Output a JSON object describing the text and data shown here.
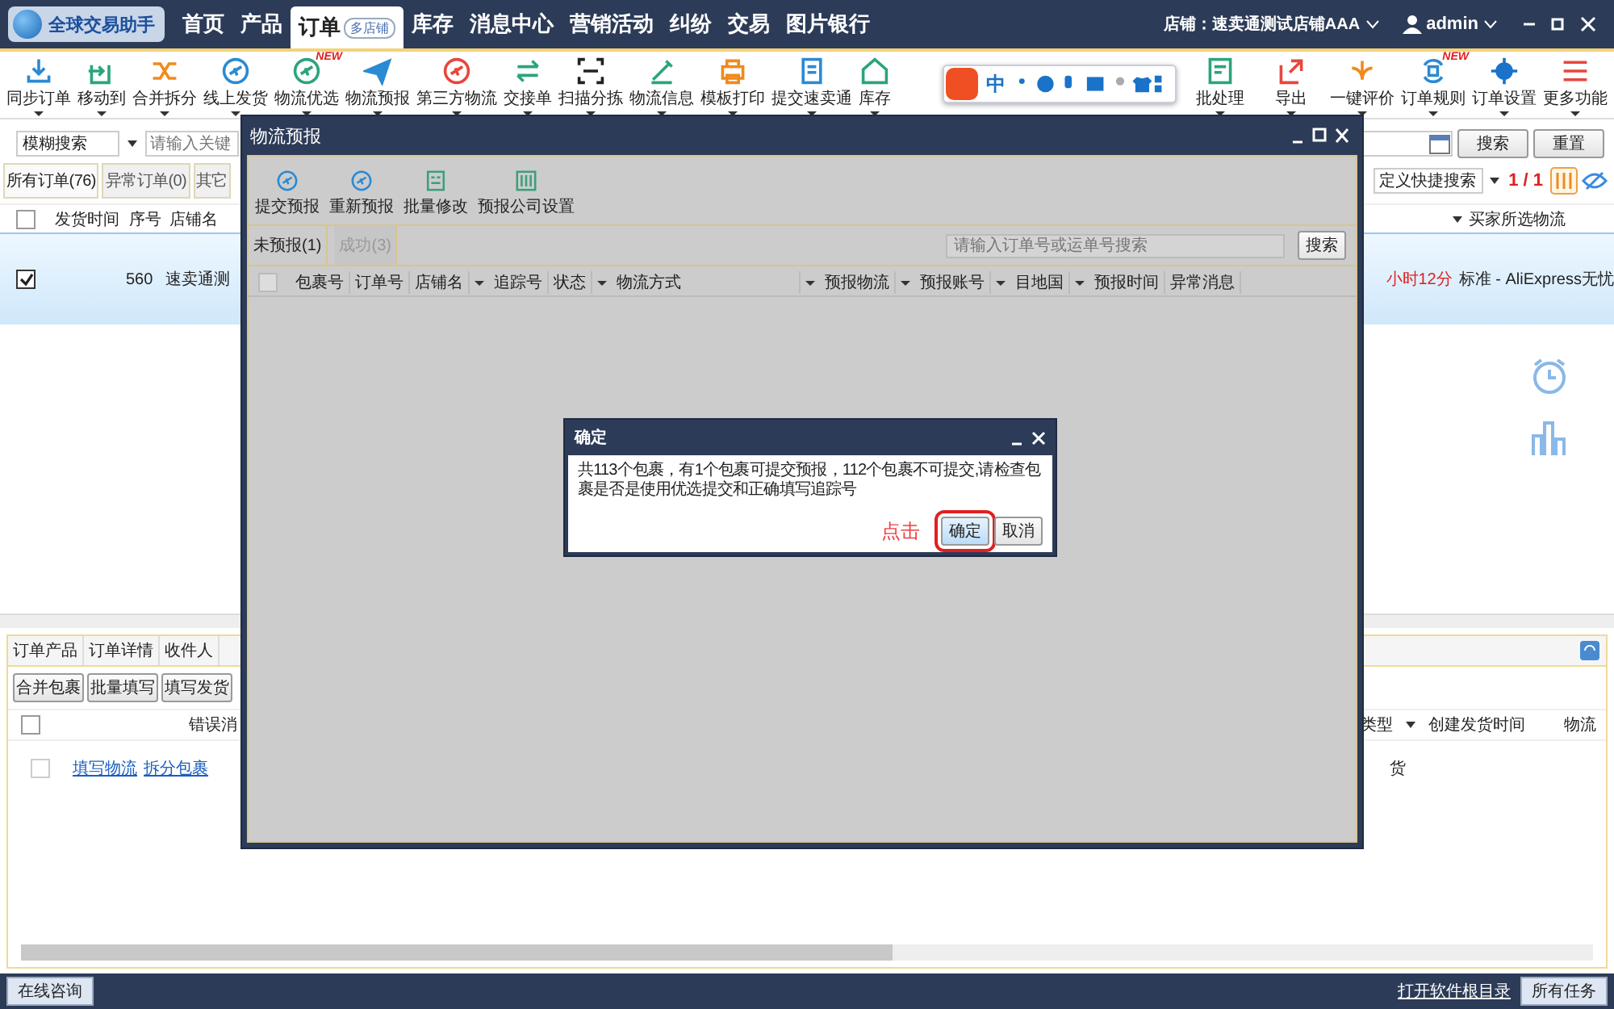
{
  "app": {
    "logo": "全球交易助手"
  },
  "nav": [
    {
      "label": "首页",
      "selected": false
    },
    {
      "label": "产品",
      "selected": false
    },
    {
      "label": "订单",
      "selected": true,
      "badge": "多店铺"
    },
    {
      "label": "库存",
      "selected": false
    },
    {
      "label": "消息中心",
      "selected": false
    },
    {
      "label": "营销活动",
      "selected": false
    },
    {
      "label": "纠纷",
      "selected": false
    },
    {
      "label": "交易",
      "selected": false
    },
    {
      "label": "图片银行",
      "selected": false
    }
  ],
  "store": "店铺：速卖通测试店铺AAA",
  "user": "admin",
  "toolbar": [
    {
      "label": "同步订单"
    },
    {
      "label": "移动到"
    },
    {
      "label": "合并拆分"
    },
    {
      "label": "线上发货"
    },
    {
      "label": "物流优选",
      "badge": "NEW"
    },
    {
      "label": "物流预报"
    },
    {
      "label": "第三方物流"
    },
    {
      "label": "交接单"
    },
    {
      "label": "扫描分拣"
    },
    {
      "label": "物流信息"
    },
    {
      "label": "模板打印"
    },
    {
      "label": "提交速卖通"
    },
    {
      "label": "库存"
    }
  ],
  "toolbar_right": [
    {
      "label": "批处理"
    },
    {
      "label": "导出"
    },
    {
      "label": "一键评价"
    },
    {
      "label": "订单规则",
      "badge": "NEW"
    },
    {
      "label": "订单设置"
    },
    {
      "label": "更多功能"
    }
  ],
  "ime": {
    "label": "中"
  },
  "filter": {
    "mode": "模糊搜索",
    "placeholder": "请输入关键",
    "search": "搜索",
    "reset": "重置"
  },
  "order_tabs": [
    {
      "label": "所有订单(76)",
      "selected": true
    },
    {
      "label": "异常订单(0)",
      "selected": false
    },
    {
      "label": "其它",
      "selected": false
    }
  ],
  "quick_search": "定义快捷搜索",
  "page": "1 / 1",
  "orders": {
    "select_all": {
      "checked": false
    },
    "columns": [
      "发货时间",
      "序号",
      "店铺名",
      "买家所选物流"
    ],
    "rows": [
      {
        "checked": true,
        "selected": true,
        "number": "560",
        "store": "速卖通测",
        "time_left": "小时12分",
        "shipping": "标准 - AliExpress无忧"
      }
    ]
  },
  "bottom": {
    "tabs": [
      "订单产品",
      "订单详情",
      "收件人"
    ],
    "buttons": [
      "合并包裹",
      "批量填写",
      "填写发货"
    ],
    "select_all": {
      "checked": false
    },
    "columns": [
      "错误消",
      "类型",
      "创建发货时间",
      "物流"
    ],
    "rows": [
      {
        "checked": false,
        "links": [
          "填写物流",
          "拆分包裹"
        ],
        "cell": "货"
      }
    ]
  },
  "status_bar": {
    "consult": "在线咨询",
    "open_dir": "打开软件根目录",
    "tasks": "所有任务"
  },
  "modal": {
    "title": "物流预报",
    "tools": [
      "提交预报",
      "重新预报",
      "批量修改",
      "预报公司设置"
    ],
    "tabs": [
      {
        "label": "未预报(1)",
        "selected": true
      },
      {
        "label": "成功(3)",
        "selected": false
      }
    ],
    "search_placeholder": "请输入订单号或运单号搜索",
    "search": "搜索",
    "select_all": {
      "checked": false
    },
    "columns": [
      {
        "label": "包裹号",
        "filter": false
      },
      {
        "label": "订单号",
        "filter": false
      },
      {
        "label": "店铺名",
        "filter": true
      },
      {
        "label": "追踪号",
        "filter": false
      },
      {
        "label": "状态",
        "filter": true
      },
      {
        "label": "物流方式",
        "filter": true
      },
      {
        "label": "预报物流",
        "filter": true
      },
      {
        "label": "预报账号",
        "filter": true
      },
      {
        "label": "目地国",
        "filter": true
      },
      {
        "label": "预报时间",
        "filter": false
      },
      {
        "label": "异常消息",
        "filter": false
      }
    ]
  },
  "confirm": {
    "title": "确定",
    "message": "共113个包裹，有1个包裹可提交预报，112个包裹不可提交,请检查包裹是否是使用优选提交和正确填写追踪号",
    "annotation": "点击",
    "buttons": [
      {
        "label": "确定",
        "highlighted": true
      },
      {
        "label": "取消",
        "highlighted": false
      }
    ]
  }
}
